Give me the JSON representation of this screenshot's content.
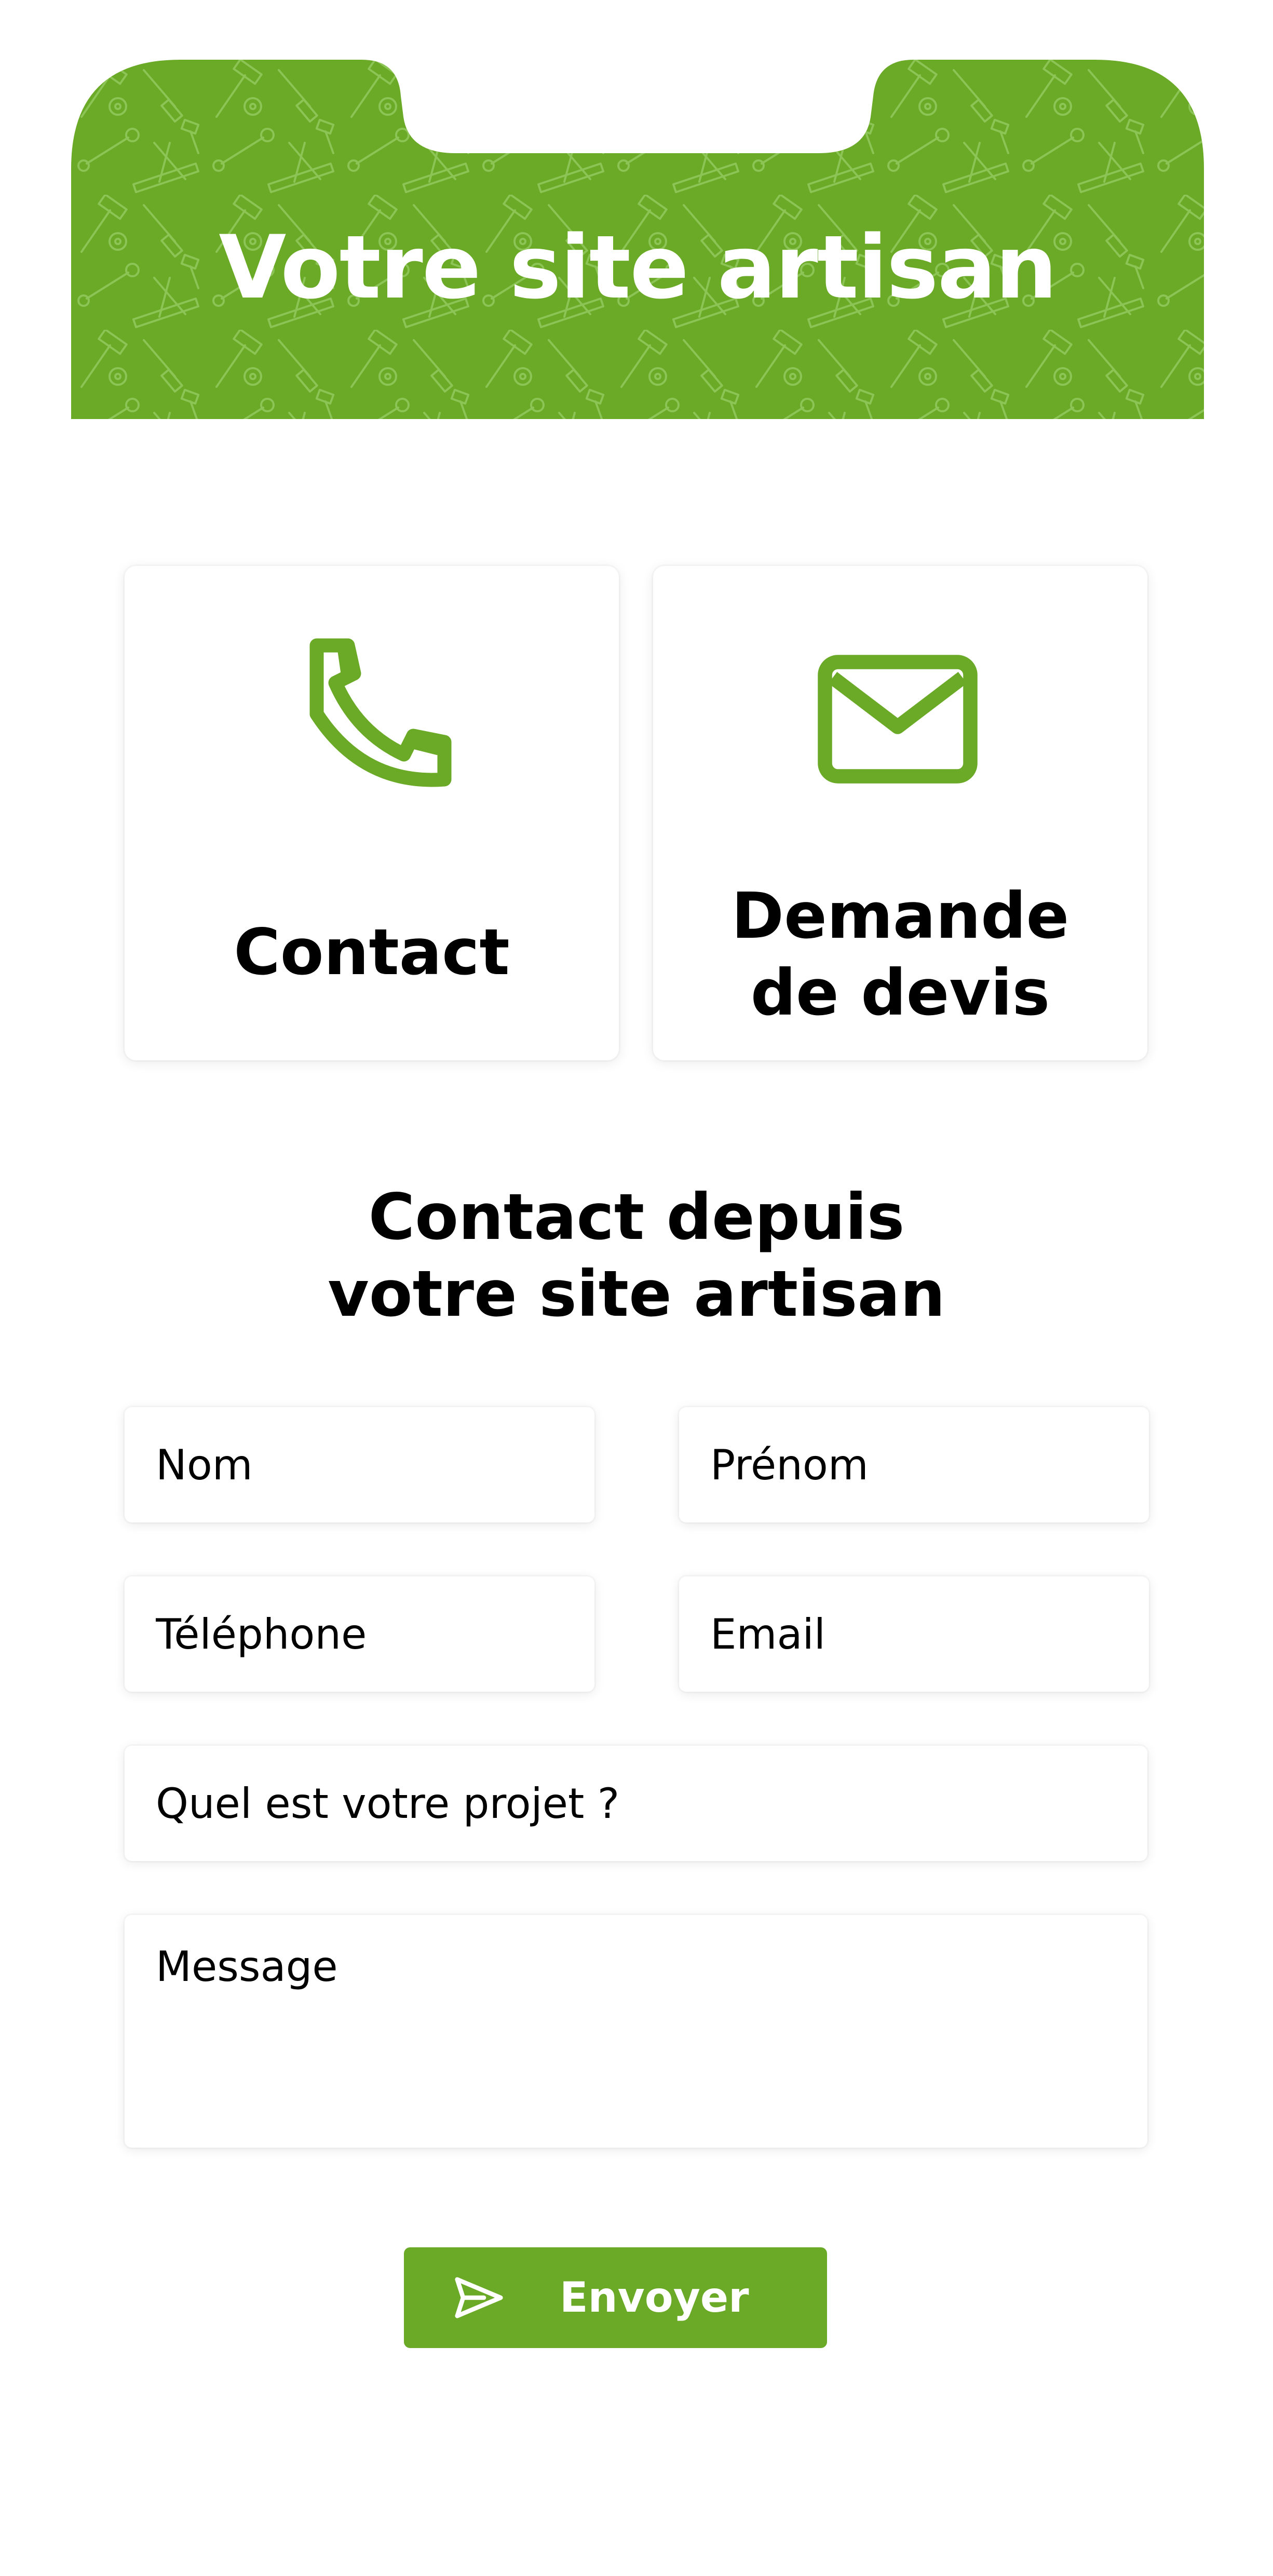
{
  "colors": {
    "brand_green": "#6aaa27",
    "pattern_line": "#8cc455",
    "text": "#000000",
    "background": "#ffffff"
  },
  "header": {
    "title": "Votre site artisan",
    "pattern_icon": "tools-pattern"
  },
  "cards": {
    "contact": {
      "icon": "phone-icon",
      "label": "Contact"
    },
    "devis": {
      "icon": "envelope-icon",
      "label_line1": "Demande",
      "label_line2": "de devis"
    }
  },
  "section": {
    "title_line1": "Contact depuis",
    "title_line2": "votre site artisan"
  },
  "form": {
    "nom_placeholder": "Nom",
    "prenom_placeholder": "Prénom",
    "telephone_placeholder": "Téléphone",
    "email_placeholder": "Email",
    "projet_placeholder": "Quel est votre projet ?",
    "message_placeholder": "Message",
    "submit_label": "Envoyer",
    "submit_icon": "send-icon"
  }
}
